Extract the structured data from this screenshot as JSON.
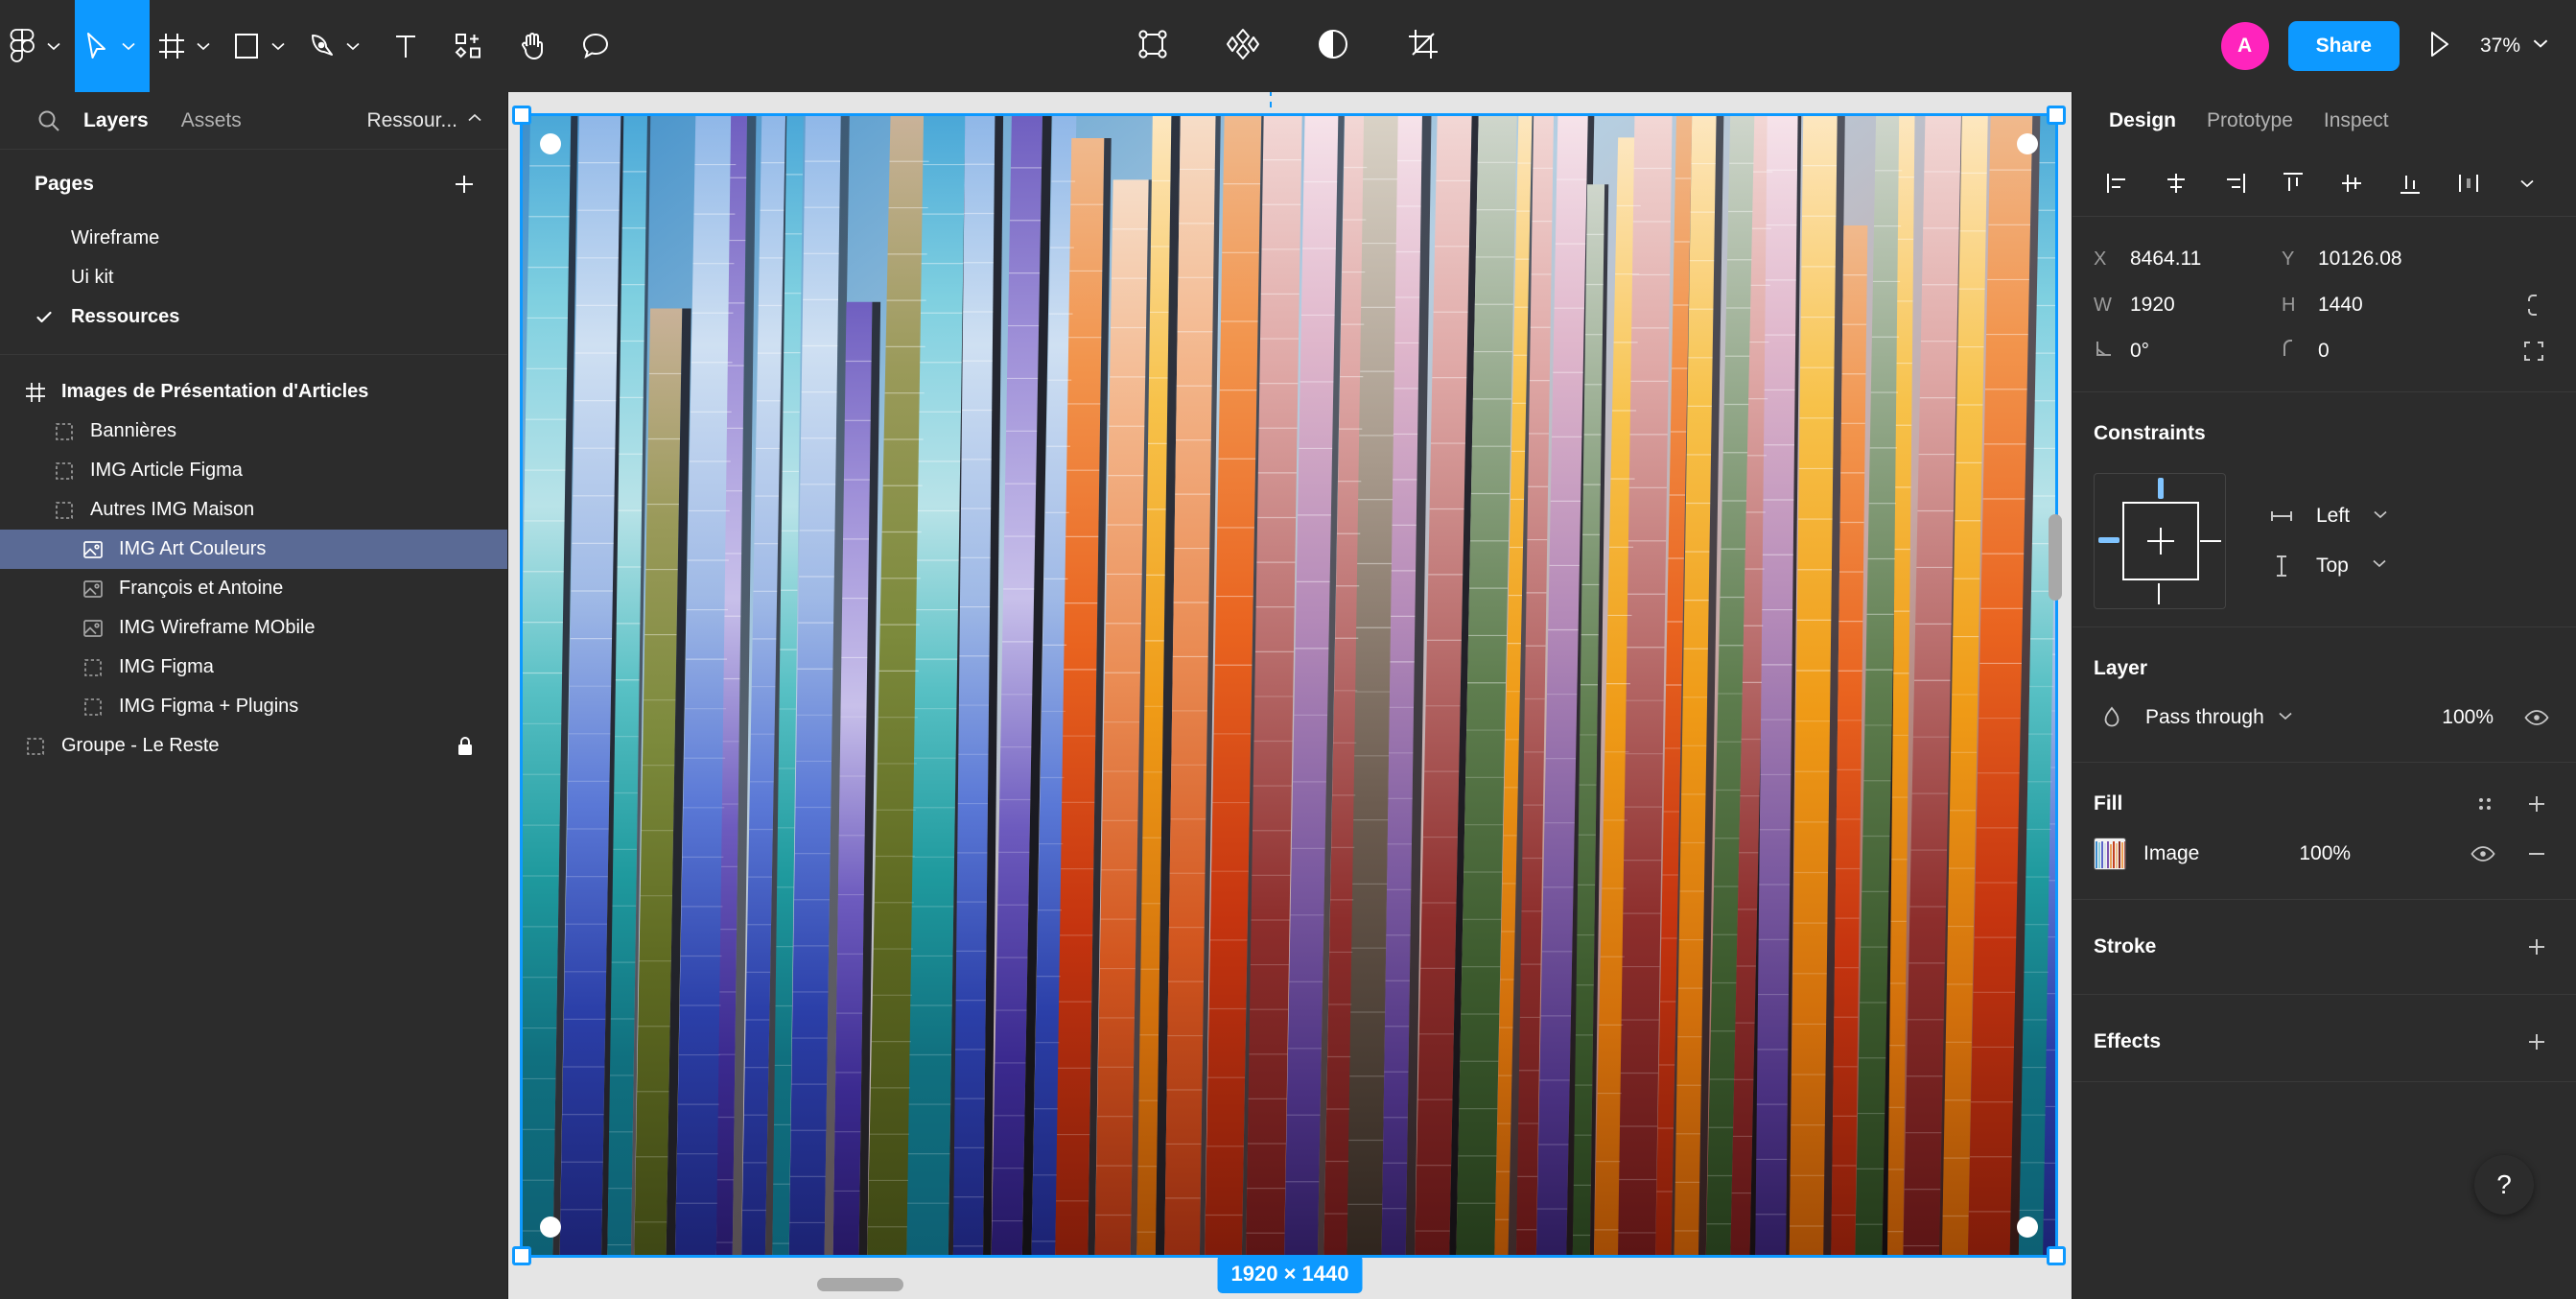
{
  "toolbar": {
    "tools": [
      {
        "name": "figma-menu",
        "icon": "figma-logo",
        "has_chevron": true,
        "active": false
      },
      {
        "name": "move-tool",
        "icon": "cursor-arrow",
        "has_chevron": true,
        "active": true
      },
      {
        "name": "frame-tool",
        "icon": "frame-grid",
        "has_chevron": true,
        "active": false
      },
      {
        "name": "shape-tool",
        "icon": "rectangle",
        "has_chevron": true,
        "active": false
      },
      {
        "name": "pen-tool",
        "icon": "pen-nib",
        "has_chevron": true,
        "active": false
      },
      {
        "name": "text-tool",
        "icon": "text-t",
        "has_chevron": false,
        "active": false
      },
      {
        "name": "resources-tool",
        "icon": "components-plus",
        "has_chevron": false,
        "active": false
      },
      {
        "name": "hand-tool",
        "icon": "hand",
        "has_chevron": false,
        "active": false
      },
      {
        "name": "comment-tool",
        "icon": "comment-bubble",
        "has_chevron": false,
        "active": false
      }
    ],
    "center_tools": [
      {
        "name": "selection-box-tool",
        "icon": "selection-nodes"
      },
      {
        "name": "plugins-tool",
        "icon": "four-diamonds"
      },
      {
        "name": "contrast-tool",
        "icon": "half-circle"
      },
      {
        "name": "crop-tool",
        "icon": "crop"
      }
    ],
    "avatar_initial": "A",
    "share_label": "Share",
    "present_icon": "play-triangle",
    "zoom_level": "37%"
  },
  "left_panel": {
    "search_icon": "search-icon",
    "tabs": [
      {
        "label": "Layers",
        "selected": true
      },
      {
        "label": "Assets",
        "selected": false
      }
    ],
    "file_name": "Ressour...",
    "pages": {
      "title": "Pages",
      "add_icon": "plus-icon",
      "items": [
        {
          "label": "Wireframe",
          "selected": false
        },
        {
          "label": "Ui kit",
          "selected": false
        },
        {
          "label": "Ressources",
          "selected": true
        }
      ]
    },
    "layers": [
      {
        "label": "Images de Présentation d'Articles",
        "icon": "frame-icon",
        "depth": 0,
        "selected": false,
        "bold": true,
        "locked": false
      },
      {
        "label": "Bannières",
        "icon": "group-icon",
        "depth": 1,
        "selected": false,
        "bold": false,
        "locked": false
      },
      {
        "label": "IMG Article Figma",
        "icon": "group-icon",
        "depth": 1,
        "selected": false,
        "bold": false,
        "locked": false
      },
      {
        "label": "Autres IMG Maison",
        "icon": "group-icon",
        "depth": 1,
        "selected": false,
        "bold": false,
        "locked": false
      },
      {
        "label": "IMG Art Couleurs",
        "icon": "image-icon",
        "depth": 2,
        "selected": true,
        "bold": false,
        "locked": false
      },
      {
        "label": "François et Antoine",
        "icon": "image-icon",
        "depth": 2,
        "selected": false,
        "bold": false,
        "locked": false
      },
      {
        "label": "IMG Wireframe MObile",
        "icon": "image-icon",
        "depth": 2,
        "selected": false,
        "bold": false,
        "locked": false
      },
      {
        "label": "IMG Figma",
        "icon": "group-icon",
        "depth": 2,
        "selected": false,
        "bold": false,
        "locked": false
      },
      {
        "label": "IMG Figma + Plugins",
        "icon": "group-icon",
        "depth": 2,
        "selected": false,
        "bold": false,
        "locked": false
      },
      {
        "label": "Groupe - Le Reste",
        "icon": "group-icon",
        "depth": 0,
        "selected": false,
        "bold": false,
        "locked": true
      }
    ]
  },
  "right_panel": {
    "tabs": [
      {
        "label": "Design",
        "selected": true
      },
      {
        "label": "Prototype",
        "selected": false
      },
      {
        "label": "Inspect",
        "selected": false
      }
    ],
    "align_buttons": [
      {
        "name": "align-left-icon"
      },
      {
        "name": "align-horizontal-center-icon"
      },
      {
        "name": "align-right-icon"
      },
      {
        "name": "align-top-icon"
      },
      {
        "name": "align-vertical-center-icon"
      },
      {
        "name": "align-bottom-icon"
      },
      {
        "name": "distribute-icon"
      }
    ],
    "transform": {
      "x_label": "X",
      "x_value": "8464.11",
      "y_label": "Y",
      "y_value": "10126.08",
      "w_label": "W",
      "w_value": "1920",
      "h_label": "H",
      "h_value": "1440",
      "rotation_value": "0°",
      "corner_radius_value": "0",
      "ratio_lock_icon": "link-icon",
      "independent-corners-icon": "corners-icon"
    },
    "constraints": {
      "title": "Constraints",
      "horizontal": "Left",
      "vertical": "Top",
      "horizontal_icon": "horizontal-constraint-icon",
      "vertical_icon": "vertical-constraint-icon"
    },
    "layer": {
      "title": "Layer",
      "blend_mode": "Pass through",
      "opacity": "100%",
      "blend_icon": "blend-drop-icon",
      "visibility_icon": "eye-icon"
    },
    "fill": {
      "title": "Fill",
      "style_icon": "styles-dots-icon",
      "add_icon": "plus-icon",
      "items": [
        {
          "name": "Image",
          "opacity": "100%",
          "visibility_icon": "eye-icon",
          "remove_icon": "minus-icon"
        }
      ]
    },
    "stroke": {
      "title": "Stroke",
      "add_icon": "plus-icon"
    },
    "effects": {
      "title": "Effects",
      "add_icon": "plus-icon"
    }
  },
  "canvas": {
    "selection_dimensions": "1920 × 1440",
    "help_label": "?",
    "accent_color": "#0d99ff",
    "selection_fill_color": "#5a6a95",
    "canvas_background": "#e5e5e5",
    "artwork_title": "IMG Art Couleurs",
    "artwork_description": "Hanging vertical paint-chip color strips forming a rainbow gradient from blue-green on the left through orange, red, pink and purple to warm orange at the bottom"
  }
}
